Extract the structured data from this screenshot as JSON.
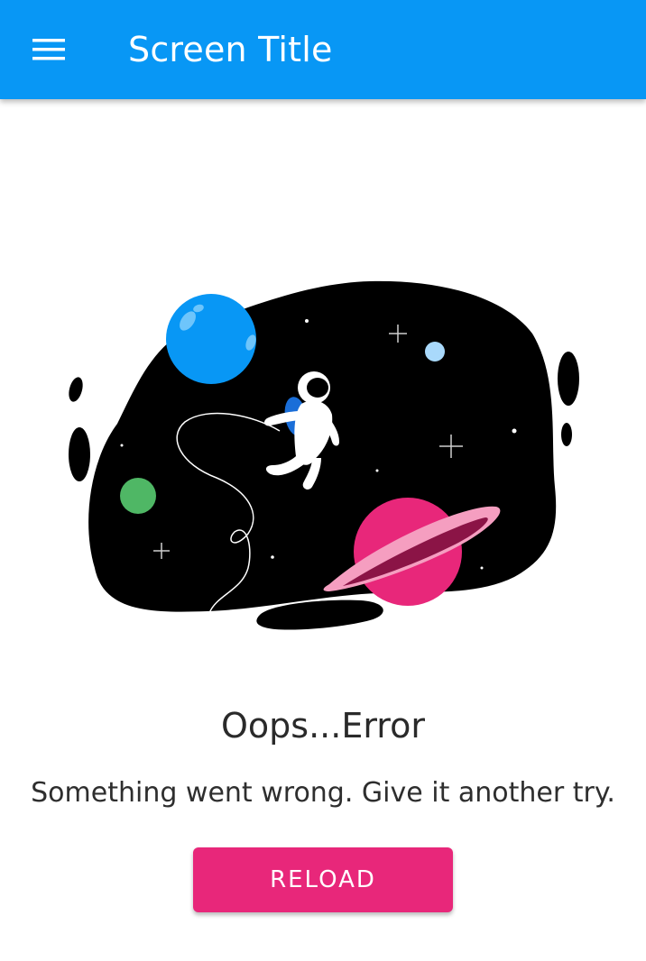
{
  "app_bar": {
    "title": "Screen Title",
    "menu_icon": "hamburger-menu-icon",
    "background_color": "#0897f5"
  },
  "illustration": {
    "subject": "astronaut-in-space-illustration"
  },
  "error": {
    "title": "Oops...Error",
    "message": "Something went wrong. Give it another try."
  },
  "actions": {
    "reload_label": "RELOAD",
    "reload_color": "#e8277a"
  }
}
